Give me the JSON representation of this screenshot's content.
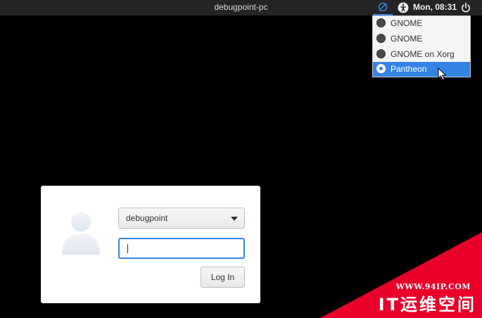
{
  "topbar": {
    "hostname": "debugpoint-pc",
    "clock": "Mon, 08:31",
    "icons": [
      "session-settings-icon",
      "accessibility-icon",
      "power-icon"
    ]
  },
  "session_menu": {
    "items": [
      {
        "label": "GNOME",
        "selected": false
      },
      {
        "label": "GNOME",
        "selected": false
      },
      {
        "label": "GNOME on Xorg",
        "selected": false
      },
      {
        "label": "Pantheon",
        "selected": true
      }
    ]
  },
  "login": {
    "username": "debugpoint",
    "password_value": "",
    "login_button_label": "Log In",
    "avatar_icon": "user-avatar-icon"
  },
  "watermark": {
    "url": "WWW.94IP.COM",
    "name": "IT运维空间"
  },
  "colors": {
    "accent": "#3584e4",
    "panel": "#242424",
    "background": "#000000",
    "watermark": "#e8002a"
  }
}
